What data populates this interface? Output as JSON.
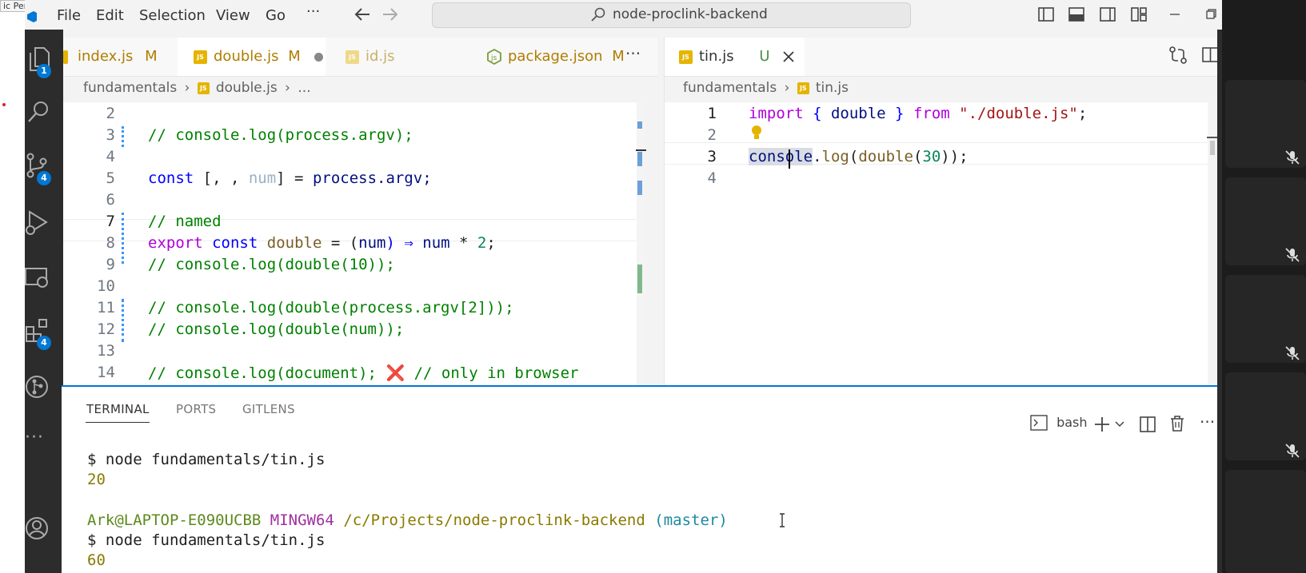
{
  "overlay_label": "ic Pen",
  "menu": [
    "File",
    "Edit",
    "Selection",
    "View",
    "Go",
    "···"
  ],
  "search": {
    "text": "node-proclink-backend"
  },
  "activity": {
    "explorer_badge": "1",
    "scm_badge": "4",
    "extensions_badge": "4",
    "more": "···"
  },
  "left_group": {
    "tabs": [
      {
        "label": "index.js",
        "status": "M"
      },
      {
        "label": "double.js",
        "status": "M"
      },
      {
        "label": "id.js",
        "status": ""
      },
      {
        "label": "package.json",
        "status": "M"
      }
    ],
    "more": "···",
    "breadcrumb": {
      "folder": "fundamentals",
      "file": "double.js",
      "tail": "..."
    },
    "line_numbers": [
      "2",
      "3",
      "4",
      "5",
      "6",
      "7",
      "8",
      "9",
      "10",
      "11",
      "12",
      "13",
      "14"
    ],
    "lines": {
      "l3": "// console.log(process.argv);",
      "l5_kw": "const",
      "l5_a": " [, , ",
      "l5_num": "num",
      "l5_b": "] = ",
      "l5_c": "process.argv;",
      "l7": "// named",
      "l8_kw": "export",
      "l8_kw2": "const",
      "l8_fn": "double",
      "l8_a": " = (",
      "l8_p": "num",
      "l8_b": ") ⇒ ",
      "l8_c": "num",
      "l8_d": " * ",
      "l8_n": "2",
      "l8_e": ";",
      "l9": "// console.log(double(10));",
      "l11": "// console.log(double(process.argv[2]));",
      "l12": "// console.log(double(num));",
      "l14_a": "// console.log(document);",
      "l14_x": "❌",
      "l14_b": "// only in browser"
    }
  },
  "right_group": {
    "tab": {
      "label": "tin.js",
      "status": "U"
    },
    "breadcrumb": {
      "folder": "fundamentals",
      "file": "tin.js"
    },
    "line_numbers": [
      "1",
      "2",
      "3",
      "4"
    ],
    "lines": {
      "l1_kw": "import",
      "l1_a": " { ",
      "l1_fn": "double",
      "l1_b": " } ",
      "l1_kw2": "from",
      "l1_str": "\"./double.js\"",
      "l1_c": ";",
      "l3_var": "console",
      "l3_a": ".",
      "l3_fn": "log",
      "l3_b": "(",
      "l3_fn2": "double",
      "l3_c": "(",
      "l3_num": "30",
      "l3_d": "));"
    }
  },
  "panel": {
    "tabs": [
      "TERMINAL",
      "PORTS",
      "GITLENS"
    ],
    "shell": "bash",
    "terminal": {
      "cmd1": "$ node fundamentals/tin.js",
      "out1": "20",
      "user": "Ark@LAPTOP-E090UCBB",
      "env": "MINGW64",
      "path": "/c/Projects/node-proclink-backend",
      "branch": "(master)",
      "cmd2": "$ node fundamentals/tin.js",
      "out2": "60"
    }
  },
  "colors": {
    "accent": "#0078d4",
    "modified": "#b07d00",
    "js_icon": "#e5b400"
  }
}
